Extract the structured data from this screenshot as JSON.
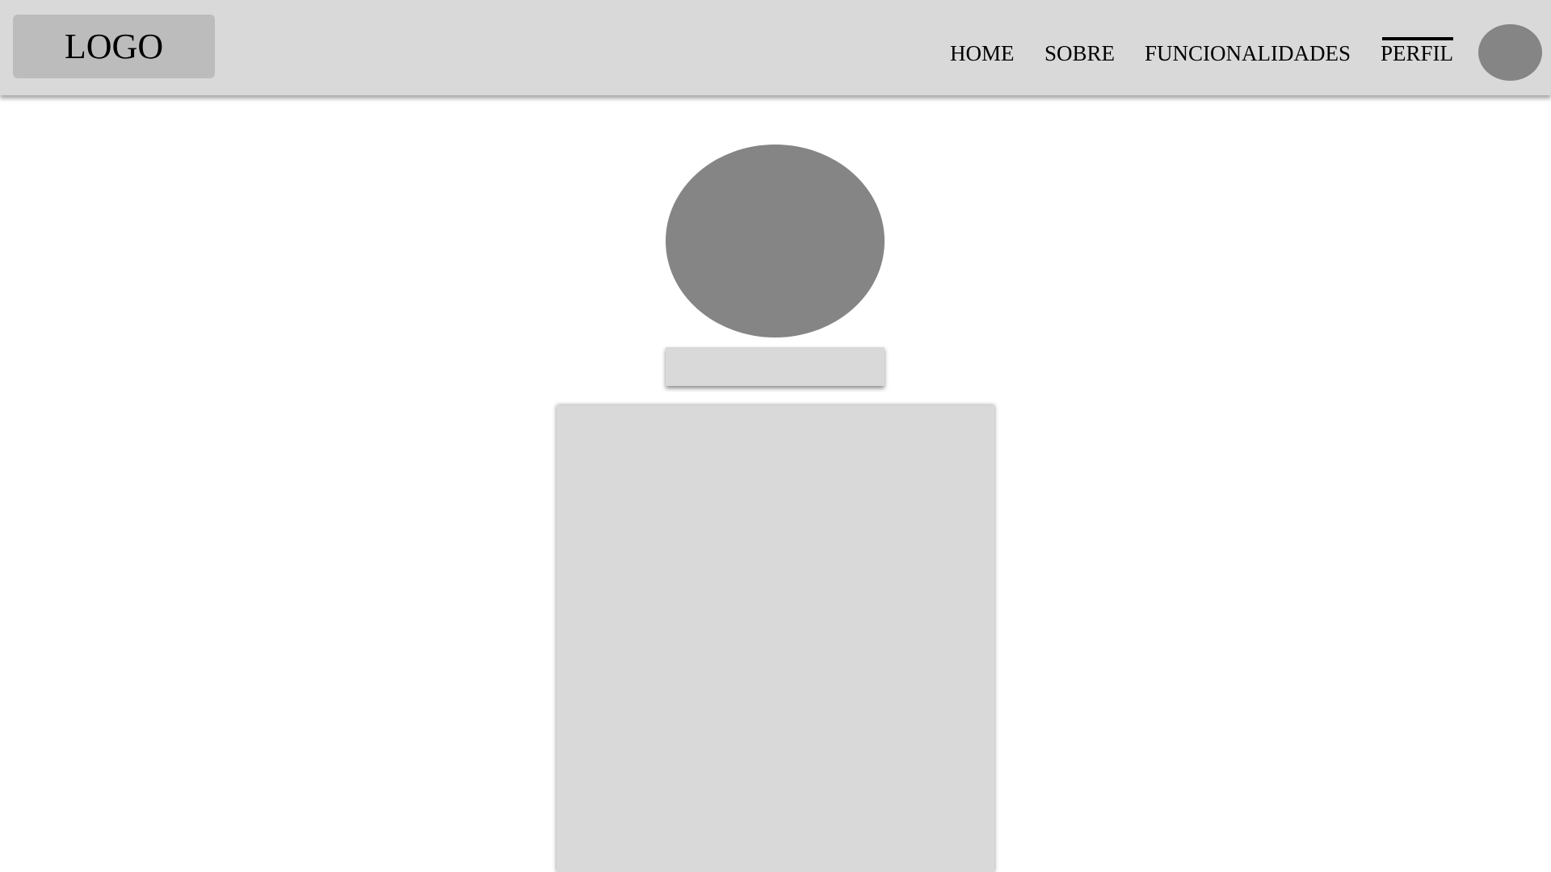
{
  "header": {
    "logo_label": "LOGO"
  },
  "nav": {
    "items": [
      {
        "label": "HOME",
        "active": false
      },
      {
        "label": "SOBRE",
        "active": false
      },
      {
        "label": "FUNCIONALIDADES",
        "active": false
      },
      {
        "label": "PERFIL",
        "active": true
      }
    ]
  },
  "colors": {
    "navbar_bg": "#d9d9d9",
    "logo_bg": "#bcbcbc",
    "avatar_placeholder": "#858585",
    "panel_bg": "#d9d9d9",
    "page_bg": "#ffffff"
  }
}
